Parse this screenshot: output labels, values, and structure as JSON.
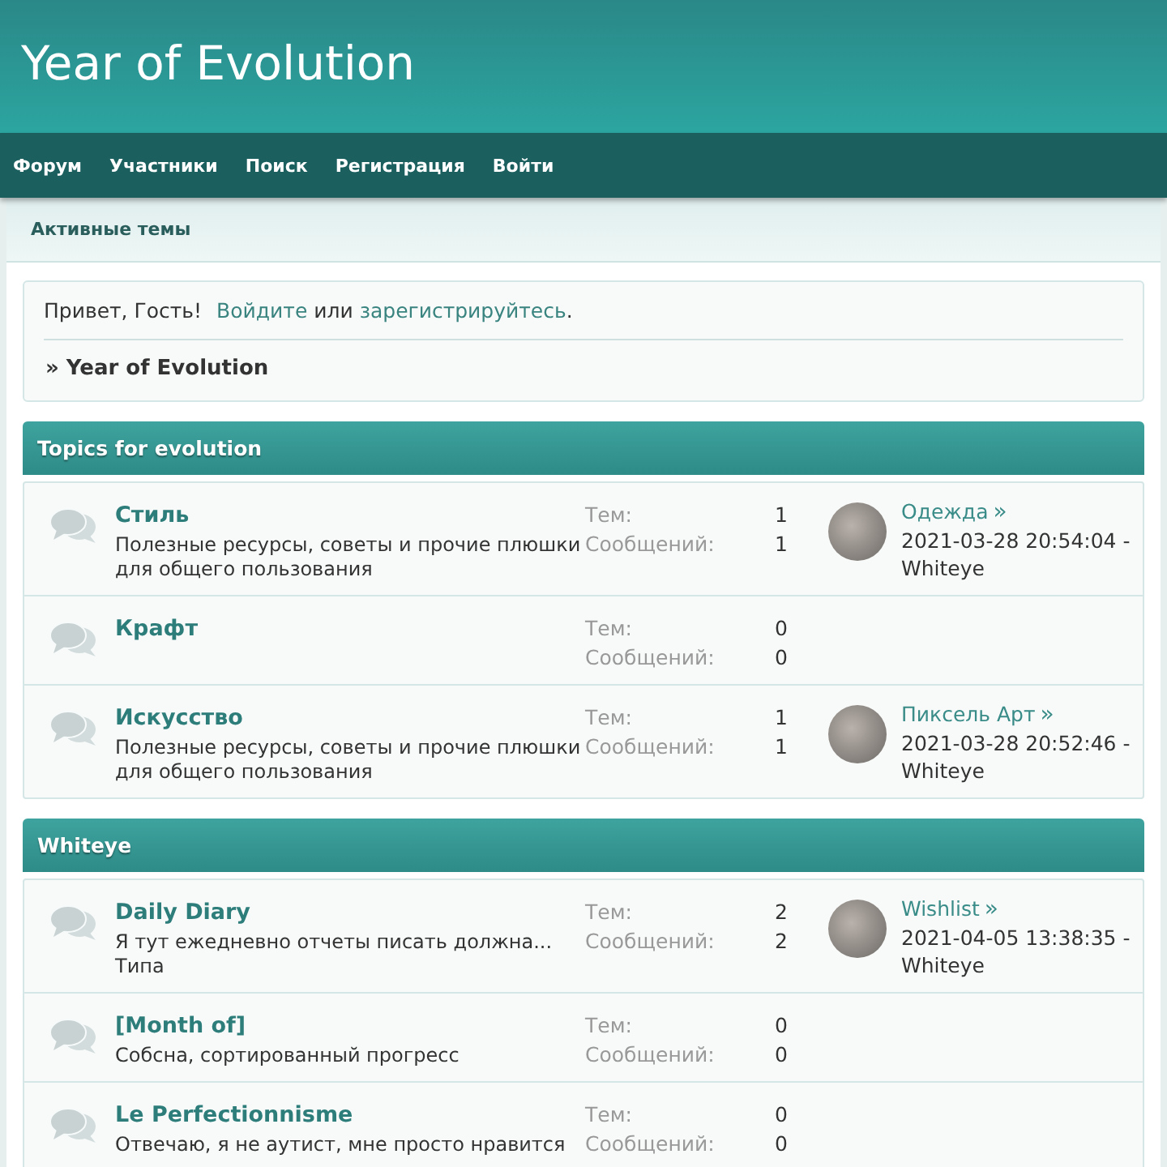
{
  "header": {
    "title": "Year of Evolution"
  },
  "nav": [
    {
      "label": "Форум"
    },
    {
      "label": "Участники"
    },
    {
      "label": "Поиск"
    },
    {
      "label": "Регистрация"
    },
    {
      "label": "Войти"
    }
  ],
  "subnav": {
    "label": "Активные темы"
  },
  "greeting": {
    "hello": "Привет, Гость!",
    "login_link": "Войдите",
    "or": "или",
    "register_link": "зарегистрируйтесь",
    "end": "."
  },
  "breadcrumb": "» Year of Evolution",
  "categories": [
    {
      "title": "Topics for evolution",
      "boards": [
        {
          "name": "Стиль",
          "description": "Полезные ресурсы, советы и прочие плюшки для общего пользования",
          "topics_label": "Тем:",
          "topics": "1",
          "posts_label": "Сообщений:",
          "posts": "1",
          "last_post": {
            "title": "Одежда",
            "arrow": "»",
            "info": "2021-03-28 20:54:04 - Whiteye"
          }
        },
        {
          "name": "Крафт",
          "topics_label": "Тем:",
          "topics": "0",
          "posts_label": "Сообщений:",
          "posts": "0"
        },
        {
          "name": "Искусство",
          "description": "Полезные ресурсы, советы и прочие плюшки для общего пользования",
          "topics_label": "Тем:",
          "topics": "1",
          "posts_label": "Сообщений:",
          "posts": "1",
          "last_post": {
            "title": "Пиксель Арт",
            "arrow": "»",
            "info": "2021-03-28 20:52:46 - Whiteye"
          }
        }
      ]
    },
    {
      "title": "Whiteye",
      "boards": [
        {
          "name": "Daily Diary",
          "description": "Я тут ежедневно отчеты писать должна... Типа",
          "topics_label": "Тем:",
          "topics": "2",
          "posts_label": "Сообщений:",
          "posts": "2",
          "last_post": {
            "title": "Wishlist",
            "arrow": "»",
            "info": "2021-04-05 13:38:35 - Whiteye"
          }
        },
        {
          "name": "[Month of]",
          "description": "Собсна, сортированный прогресс",
          "topics_label": "Тем:",
          "topics": "0",
          "posts_label": "Сообщений:",
          "posts": "0"
        },
        {
          "name": "Le Perfectionnisme",
          "description": "Отвечаю, я не аутист, мне просто нравится",
          "topics_label": "Тем:",
          "topics": "0",
          "posts_label": "Сообщений:",
          "posts": "0"
        }
      ]
    }
  ]
}
